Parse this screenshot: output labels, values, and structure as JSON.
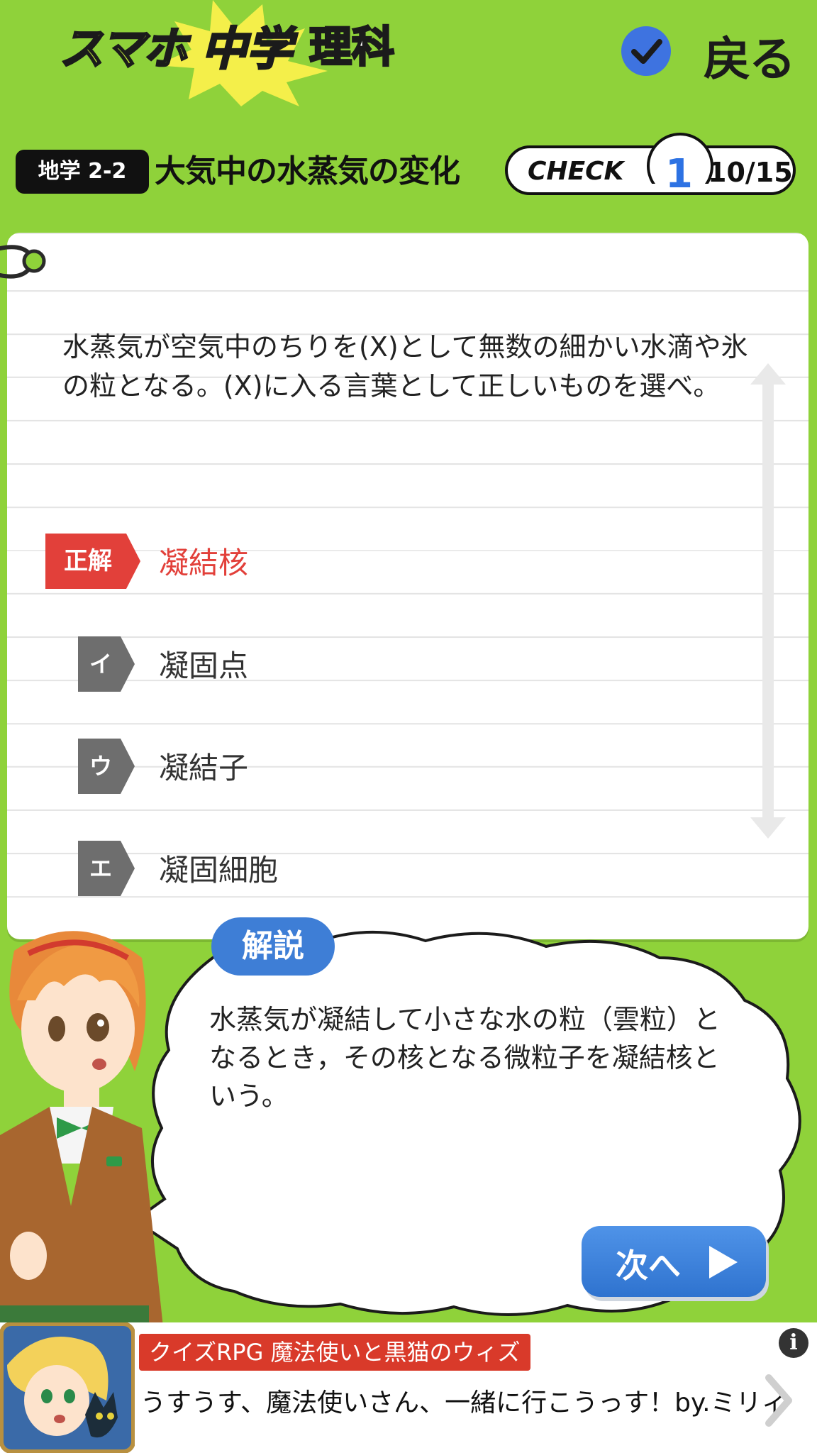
{
  "header": {
    "logo_part1": "スマホ",
    "logo_part2": "中学",
    "logo_part3": "理科",
    "back_label": "戻る"
  },
  "lesson": {
    "unit_badge": "地学 2-2",
    "title": "大気中の水蒸気の変化",
    "check_label": "CHECK",
    "check_number": "1",
    "progress": "10/15"
  },
  "question": {
    "text": "水蒸気が空気中のちりを(X)として無数の細かい水滴や氷の粒となる。(X)に入る言葉として正しいものを選べ。",
    "choices": [
      {
        "tag": "正解",
        "text": "凝結核",
        "correct": true
      },
      {
        "tag": "イ",
        "text": "凝固点",
        "correct": false
      },
      {
        "tag": "ウ",
        "text": "凝結子",
        "correct": false
      },
      {
        "tag": "エ",
        "text": "凝固細胞",
        "correct": false
      }
    ]
  },
  "explanation": {
    "tab_label": "解説",
    "text": "水蒸気が凝結して小さな水の粒（雲粒）となるとき，その核となる微粒子を凝結核という。",
    "next_label": "次へ"
  },
  "ad": {
    "title": "クイズRPG 魔法使いと黒猫のウィズ",
    "description": "うすうす、魔法使いさん、一緒に行こうっす！by.ミリィ",
    "info_icon": "i"
  },
  "colors": {
    "background": "#8fd23a",
    "accent_blue": "#3e73e0",
    "correct_red": "#e2403a",
    "choice_gray": "#6e6e6e"
  }
}
